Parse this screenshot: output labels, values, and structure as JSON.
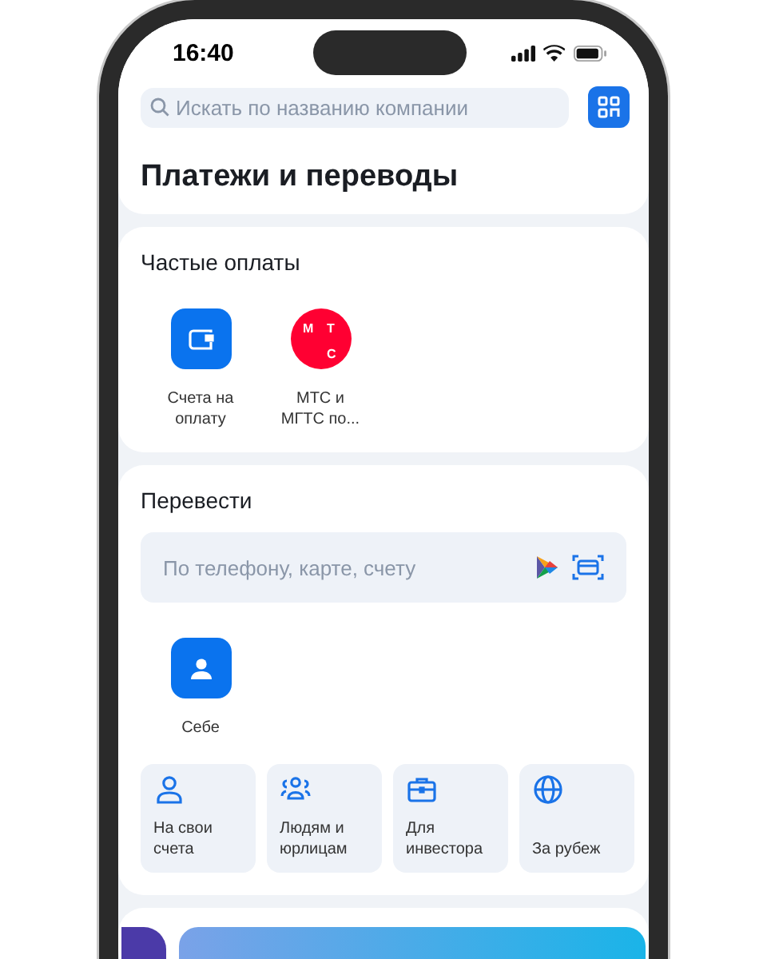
{
  "status_bar": {
    "time": "16:40"
  },
  "search": {
    "placeholder": "Искать по названию компании"
  },
  "title": "Платежи и переводы",
  "frequent": {
    "title": "Частые оплаты",
    "items": [
      {
        "kind": "wallet",
        "label": "Счета на оплату"
      },
      {
        "kind": "logo",
        "logo_letters": [
          "М",
          "Т",
          "С"
        ],
        "color": "#ff0032",
        "label": "МТС и МГТС по..."
      }
    ]
  },
  "transfer": {
    "title": "Перевести",
    "field": {
      "placeholder": "По телефону, карте, счету"
    },
    "contacts": [
      {
        "kind": "self",
        "label": "Себе"
      }
    ],
    "tiles": [
      {
        "kind": "person",
        "label": "На свои счета"
      },
      {
        "kind": "people",
        "label": "Людям и юрлицам"
      },
      {
        "kind": "briefcase",
        "label": "Для инвестора"
      },
      {
        "kind": "globe",
        "label": "За рубеж"
      }
    ]
  }
}
